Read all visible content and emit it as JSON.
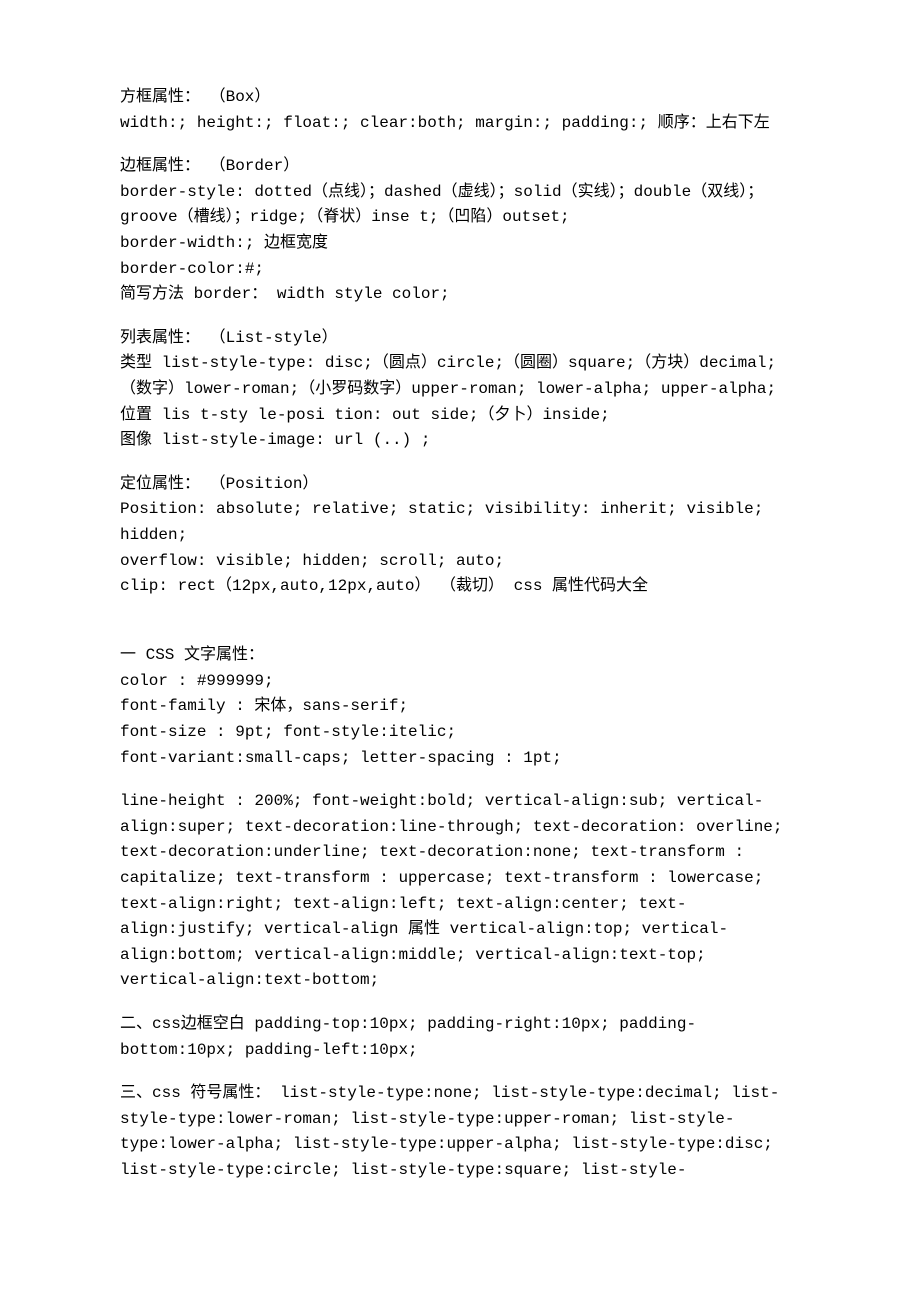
{
  "p1": {
    "l1": "方框属性： （Box）",
    "l2": "width:; height:; float:; clear:both; margin:; padding:; 顺序：上右下左"
  },
  "p2": {
    "l1": "边框属性： （Border）",
    "l2": "border-style: dotted（点线）；dashed（虚线）；solid（实线）；double（双线）； groove（槽线）；ridge;（脊状）inse t;（凹陷）outset;",
    "l3": "border-width:; 边框宽度",
    "l4": "border-color:#;",
    "l5": "简写方法 border： width style color;"
  },
  "p3": {
    "l1": "列表属性： （List-style）",
    "l2": "类型 list-style-type: disc;（圆点）circle;（圆圈）square;（方块）decimal;（数字）lower-roman;（小罗码数字）upper-roman; lower-alpha; upper-alpha;",
    "l3": "位置 lis t-sty le-posi tion: out side;（夕卜）inside;",
    "l4": "图像 list-style-image: url (..) ;"
  },
  "p4": {
    "l1": "定位属性： （Position）",
    "l2": "Position: absolute; relative; static; visibility: inherit; visible; hidden;",
    "l3": "overflow: visible; hidden; scroll; auto;",
    "l4": "clip: rect（12px,auto,12px,auto） （裁切） css 属性代码大全"
  },
  "p5": {
    "l1": "一 CSS 文字属性：",
    "l2": "color : #999999;",
    "l3": "font-family : 宋体，sans-serif;",
    "l4": "font-size : 9pt; font-style:itelic;",
    "l5": "font-variant:small-caps; letter-spacing : 1pt;"
  },
  "p6": {
    "l1": "line-height : 200%; font-weight:bold; vertical-align:sub; vertical-align:super; text-decoration:line-through; text-decoration: overline; text-decoration:underline; text-decoration:none; text-transform : capitalize; text-transform : uppercase; text-transform : lowercase; text-align:right; text-align:left; text-align:center; text-align:justify; vertical-align 属性 vertical-align:top; vertical-align:bottom; vertical-align:middle; vertical-align:text-top; vertical-align:text-bottom;"
  },
  "p7": {
    "l1": "二、css边框空白 padding-top:10px; padding-right:10px; padding-bottom:10px; padding-left:10px;"
  },
  "p8": {
    "l1": "三、css 符号属性： list-style-type:none; list-style-type:decimal; list-style-type:lower-roman; list-style-type:upper-roman; list-style-type:lower-alpha; list-style-type:upper-alpha; list-style-type:disc; list-style-type:circle; list-style-type:square; list-style-"
  }
}
